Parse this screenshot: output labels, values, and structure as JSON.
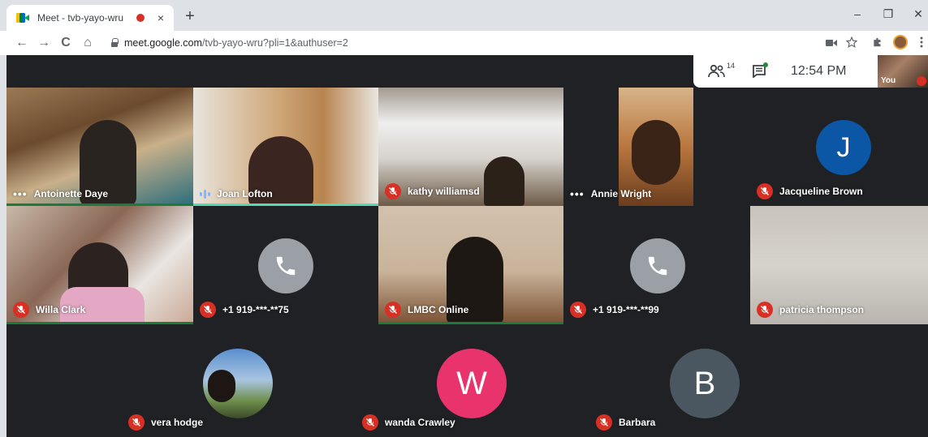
{
  "browser": {
    "tab_title": "Meet - tvb-yayo-wru",
    "tab_close": "×",
    "new_tab": "+",
    "minimize": "–",
    "restore": "❐",
    "close": "✕",
    "back": "←",
    "forward": "→",
    "reload": "C",
    "home": "⌂",
    "url_host": "meet.google.com",
    "url_path": "/tvb-yayo-wru?pli=1&authuser=2",
    "recording_color": "#d93025"
  },
  "meet": {
    "participant_count": "14",
    "time": "12:54 PM",
    "self_label": "You",
    "colors": {
      "background": "#202124",
      "muted": "#d93025",
      "speaking": "#5bd6b2"
    },
    "participants": [
      {
        "name": "Antoinette Daye",
        "status": "active"
      },
      {
        "name": "Joan Lofton",
        "status": "speaking"
      },
      {
        "name": "kathy williamsd",
        "status": "muted"
      },
      {
        "name": "Annie Wright",
        "status": "active"
      },
      {
        "name": "Jacqueline Brown",
        "status": "muted",
        "initial": "J",
        "avatar_color": "#0b57a5"
      },
      {
        "name": "Willa Clark",
        "status": "muted"
      },
      {
        "name": "+1 919-***-**75",
        "status": "muted",
        "icon": "phone-icon",
        "avatar_color": "#9aa0a6"
      },
      {
        "name": "LMBC Online",
        "status": "muted"
      },
      {
        "name": "+1 919-***-**99",
        "status": "muted",
        "icon": "phone-icon",
        "avatar_color": "#9aa0a6"
      },
      {
        "name": "patricia thompson",
        "status": "muted"
      },
      {
        "name": "vera hodge",
        "status": "muted"
      },
      {
        "name": "wanda Crawley",
        "status": "muted",
        "initial": "W",
        "avatar_color": "#e8336d"
      },
      {
        "name": "Barbara",
        "status": "muted",
        "initial": "B",
        "avatar_color": "#4a5760"
      }
    ]
  }
}
